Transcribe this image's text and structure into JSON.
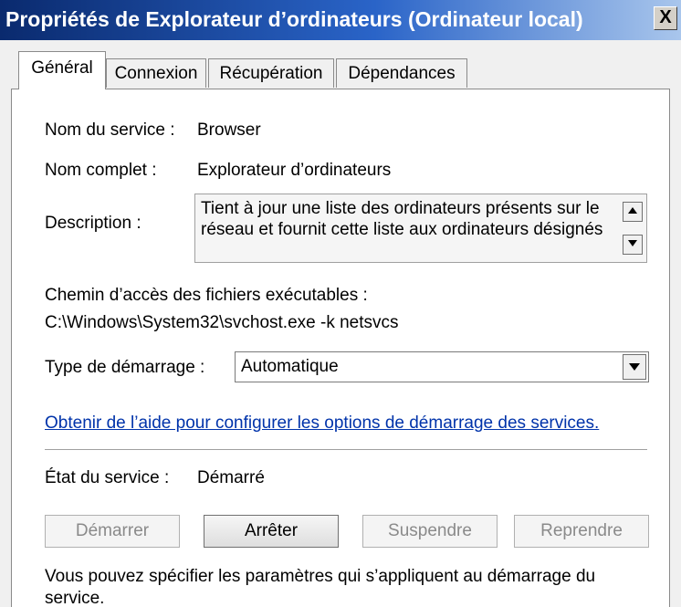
{
  "window": {
    "title": "Propriétés de Explorateur d’ordinateurs (Ordinateur local)",
    "close_label": "X"
  },
  "tabs": [
    {
      "label": "Général",
      "active": true
    },
    {
      "label": "Connexion",
      "active": false
    },
    {
      "label": "Récupération",
      "active": false
    },
    {
      "label": "Dépendances",
      "active": false
    }
  ],
  "general": {
    "service_name_label": "Nom du service :",
    "service_name_value": "Browser",
    "display_name_label": "Nom complet :",
    "display_name_value": "Explorateur d’ordinateurs",
    "description_label": "Description :",
    "description_value": "Tient à jour une liste des ordinateurs présents sur le réseau et fournit cette liste aux ordinateurs désignés",
    "path_label": "Chemin d’accès des fichiers exécutables :",
    "path_value": "C:\\Windows\\System32\\svchost.exe -k netsvcs",
    "startup_type_label": "Type de démarrage :",
    "startup_type_value": "Automatique",
    "help_link": "Obtenir de l’aide pour configurer les options de démarrage des services.",
    "status_label": "État du service :",
    "status_value": "Démarré",
    "buttons": {
      "start": "Démarrer",
      "stop": "Arrêter",
      "pause": "Suspendre",
      "resume": "Reprendre"
    },
    "footer_text": "Vous pouvez spécifier les paramètres qui s’appliquent au démarrage du service."
  }
}
